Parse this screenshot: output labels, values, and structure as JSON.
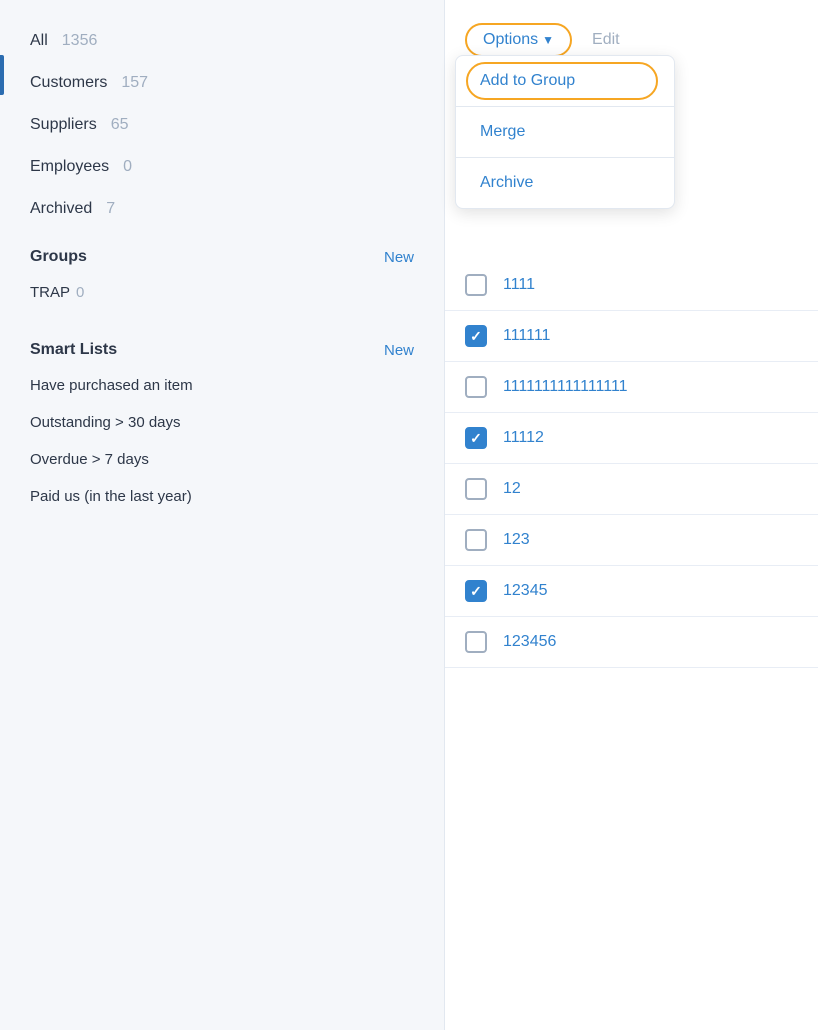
{
  "sidebar": {
    "sections": [
      {
        "type": "item",
        "label": "All",
        "count": "1356",
        "active": true
      },
      {
        "type": "item",
        "label": "Customers",
        "count": "157"
      },
      {
        "type": "item",
        "label": "Suppliers",
        "count": "65"
      },
      {
        "type": "item",
        "label": "Employees",
        "count": "0"
      },
      {
        "type": "item",
        "label": "Archived",
        "count": "7"
      }
    ],
    "groups_label": "Groups",
    "groups_new": "New",
    "groups": [
      {
        "label": "TRAP",
        "count": "0"
      }
    ],
    "smart_lists_label": "Smart Lists",
    "smart_lists_new": "New",
    "smart_lists": [
      {
        "label": "Have purchased an item"
      },
      {
        "label": "Outstanding > 30 days"
      },
      {
        "label": "Overdue > 7 days"
      },
      {
        "label": "Paid us (in the last year)"
      }
    ]
  },
  "header": {
    "options_label": "Options",
    "edit_label": "Edit"
  },
  "dropdown": {
    "items": [
      {
        "label": "Add to Group",
        "highlighted": true
      },
      {
        "label": "Merge"
      },
      {
        "label": "Archive"
      }
    ]
  },
  "contacts": [
    {
      "name": "1111",
      "checked": false
    },
    {
      "name": "111111",
      "checked": true
    },
    {
      "name": "1111111111111111",
      "checked": false
    },
    {
      "name": "11112",
      "checked": true
    },
    {
      "name": "12",
      "checked": false
    },
    {
      "name": "123",
      "checked": false
    },
    {
      "name": "12345",
      "checked": true
    },
    {
      "name": "123456",
      "checked": false
    }
  ]
}
